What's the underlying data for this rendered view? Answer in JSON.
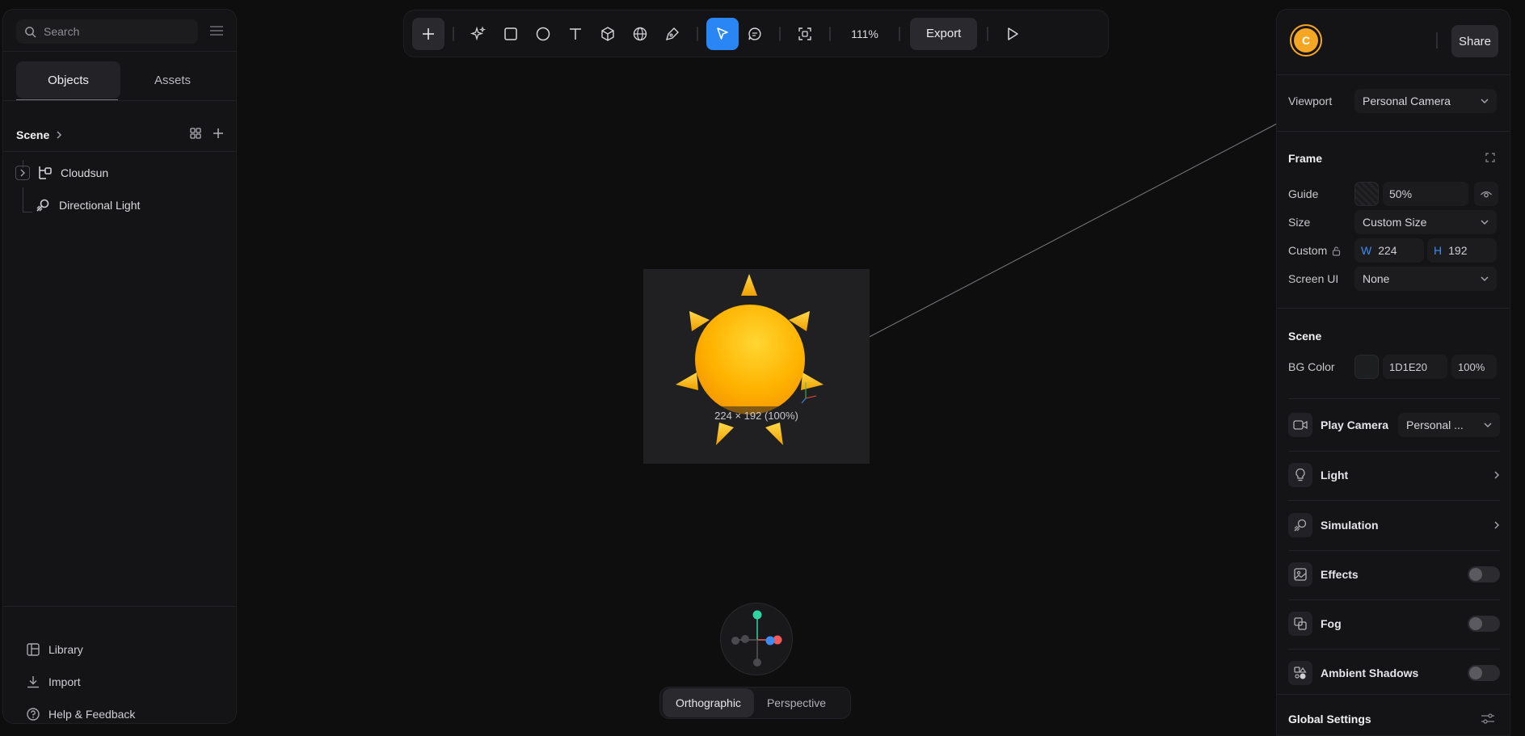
{
  "sidebar": {
    "search_placeholder": "Search",
    "tabs": [
      {
        "label": "Objects"
      },
      {
        "label": "Assets"
      }
    ],
    "scene_title": "Scene",
    "tree": [
      {
        "label": "Cloudsun"
      },
      {
        "label": "Directional Light"
      }
    ],
    "links": [
      {
        "label": "Library"
      },
      {
        "label": "Import"
      },
      {
        "label": "Help & Feedback"
      }
    ]
  },
  "toolbar": {
    "zoom": "111%",
    "export_label": "Export"
  },
  "canvas": {
    "frame_label": "224 × 192 (100%)",
    "view_options": [
      {
        "label": "Orthographic"
      },
      {
        "label": "Perspective"
      }
    ],
    "active_view": "Orthographic"
  },
  "inspector": {
    "avatar_initial": "C",
    "share_label": "Share",
    "viewport_label": "Viewport",
    "viewport_value": "Personal Camera",
    "frame_title": "Frame",
    "guide_label": "Guide",
    "guide_value": "50%",
    "size_label": "Size",
    "size_value": "Custom Size",
    "custom_label": "Custom",
    "width_prefix": "W",
    "width_value": "224",
    "height_prefix": "H",
    "height_value": "192",
    "screen_ui_label": "Screen UI",
    "screen_ui_value": "None",
    "scene_title": "Scene",
    "bg_color_label": "BG Color",
    "bg_color_hex": "1D1E20",
    "bg_opacity": "100%",
    "play_camera_label": "Play Camera",
    "play_camera_value": "Personal ...",
    "light_label": "Light",
    "simulation_label": "Simulation",
    "effects_label": "Effects",
    "fog_label": "Fog",
    "ambient_shadows_label": "Ambient Shadows",
    "global_settings_label": "Global Settings"
  },
  "colors": {
    "accent": "#2b86f5",
    "avatar": "#f5a623",
    "sun": "#ffb000",
    "gizmo_y": "#2fd4a1",
    "gizmo_x": "#f25a5a",
    "gizmo_z": "#3b8df5"
  }
}
